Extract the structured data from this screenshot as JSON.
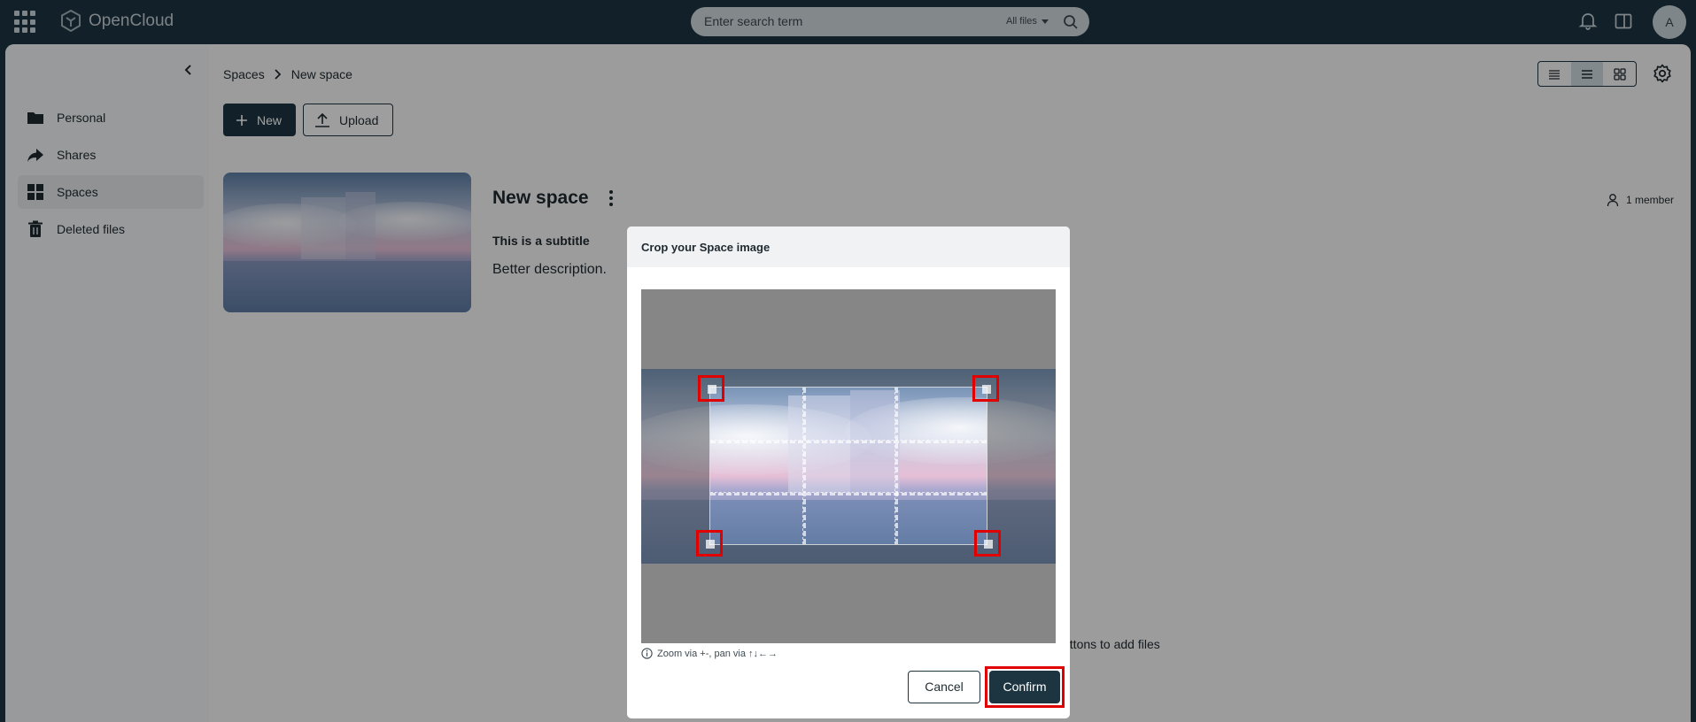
{
  "app": {
    "name": "OpenCloud"
  },
  "search": {
    "placeholder": "Enter search term",
    "scope": "All files"
  },
  "user": {
    "avatar_initial": "A"
  },
  "sidebar": {
    "items": [
      {
        "label": "Personal",
        "icon": "folder-icon"
      },
      {
        "label": "Shares",
        "icon": "share-icon"
      },
      {
        "label": "Spaces",
        "icon": "spaces-grid-icon",
        "active": true
      },
      {
        "label": "Deleted files",
        "icon": "trash-icon"
      }
    ]
  },
  "breadcrumb": {
    "root": "Spaces",
    "current": "New space"
  },
  "toolbar": {
    "new_label": "New",
    "upload_label": "Upload"
  },
  "space": {
    "title": "New space",
    "subtitle": "This is a subtitle",
    "description": "Better description.",
    "members": "1 member"
  },
  "empty_hint": "uttons to add files",
  "modal": {
    "title": "Crop your Space image",
    "hint": "Zoom via +-, pan via ↑↓←→",
    "cancel_label": "Cancel",
    "confirm_label": "Confirm"
  },
  "colors": {
    "topbar": "#1d3541",
    "primary_button": "#1d3541",
    "highlight": "#e00000"
  }
}
